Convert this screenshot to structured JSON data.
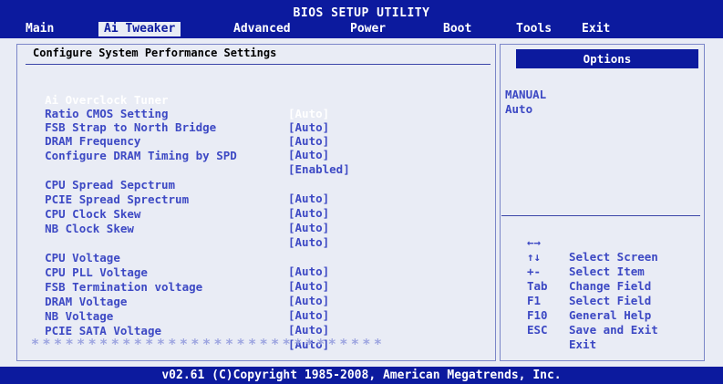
{
  "header": {
    "title": "BIOS SETUP UTILITY",
    "menu": [
      {
        "label": "Main",
        "active": false
      },
      {
        "label": "Ai Tweaker",
        "active": true
      },
      {
        "label": "Advanced",
        "active": false
      },
      {
        "label": "Power",
        "active": false
      },
      {
        "label": "Boot",
        "active": false
      },
      {
        "label": "Tools",
        "active": false
      },
      {
        "label": "Exit",
        "active": false
      }
    ]
  },
  "panel": {
    "heading": "Configure System Performance Settings",
    "settings": [
      {
        "label": "Ai Overclock Tuner",
        "value": "[Auto]"
      },
      {
        "label": "Ratio CMOS Setting",
        "value": "[Auto]"
      },
      {
        "label": "FSB Strap to North Bridge",
        "value": "[Auto]"
      },
      {
        "label": "DRAM Frequency",
        "value": "[Auto]"
      },
      {
        "label": "Configure DRAM Timing by SPD",
        "value": "[Enabled]"
      },
      {
        "label": "CPU Spread Sepctrum",
        "value": "[Auto]"
      },
      {
        "label": "PCIE Spread Sprectrum",
        "value": "[Auto]"
      },
      {
        "label": "CPU Clock Skew",
        "value": "[Auto]"
      },
      {
        "label": "NB Clock Skew",
        "value": "[Auto]"
      },
      {
        "label": "CPU Voltage",
        "value": "[Auto]"
      },
      {
        "label": "CPU PLL Voltage",
        "value": "[Auto]"
      },
      {
        "label": "FSB Termination voltage",
        "value": "[Auto]"
      },
      {
        "label": "DRAM Voltage",
        "value": "[Auto]"
      },
      {
        "label": "NB Voltage",
        "value": "[Auto]"
      },
      {
        "label": "PCIE SATA Voltage",
        "value": "[Auto]"
      }
    ],
    "stars": "*******************************"
  },
  "options": {
    "title": "Options",
    "items": [
      "MANUAL",
      "Auto"
    ]
  },
  "help": [
    {
      "key": "←→",
      "text": "Select Screen"
    },
    {
      "key": "↑↓",
      "text": "Select Item"
    },
    {
      "key": "+-",
      "text": "Change Field"
    },
    {
      "key": "Tab",
      "text": "Select Field"
    },
    {
      "key": "F1",
      "text": "General Help"
    },
    {
      "key": "F10",
      "text": "Save and Exit"
    },
    {
      "key": "ESC",
      "text": "Exit"
    }
  ],
  "footer": "v02.61 (C)Copyright 1985-2008, American Megatrends, Inc.",
  "colors": {
    "background_blue": "#0c1a9e",
    "panel_bg": "#e9ecf5",
    "text_blue": "#3d49c4"
  }
}
